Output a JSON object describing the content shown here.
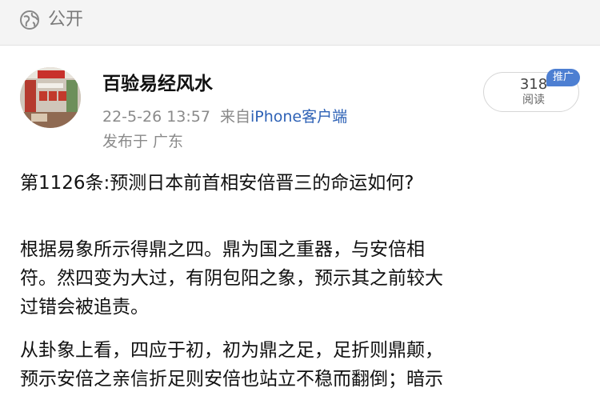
{
  "visibility": {
    "icon": "globe-icon",
    "label": "公开"
  },
  "post": {
    "author": {
      "name": "百验易经风水",
      "avatar_icon": "avatar-shop-photo"
    },
    "datetime": "22-5-26 13:57",
    "source_prefix": "来自",
    "source_client": "iPhone客户端",
    "location": "发布于 广东",
    "views": {
      "count": "318",
      "label": "阅读"
    },
    "promo_badge": "推广",
    "title": "第1126条:预测日本前首相安倍晋三的命运如何?",
    "body": [
      [
        "  根据易象所示得鼎之四。鼎为国之重器，与安倍相",
        "符。然四变为大过，有阴包阳之象，预示其之前较大",
        "过错会被追责。"
      ],
      [
        "  从卦象上看，四应于初，初为鼎之足，足折则鼎颠，",
        "预示安倍之亲信折足则安倍也站立不稳而翻倒；暗示"
      ]
    ]
  },
  "colors": {
    "link": "#2e62b6",
    "meta": "#8a8a8a",
    "badge": "#4d7fd2",
    "topbar_bg": "#f4f4f4"
  }
}
